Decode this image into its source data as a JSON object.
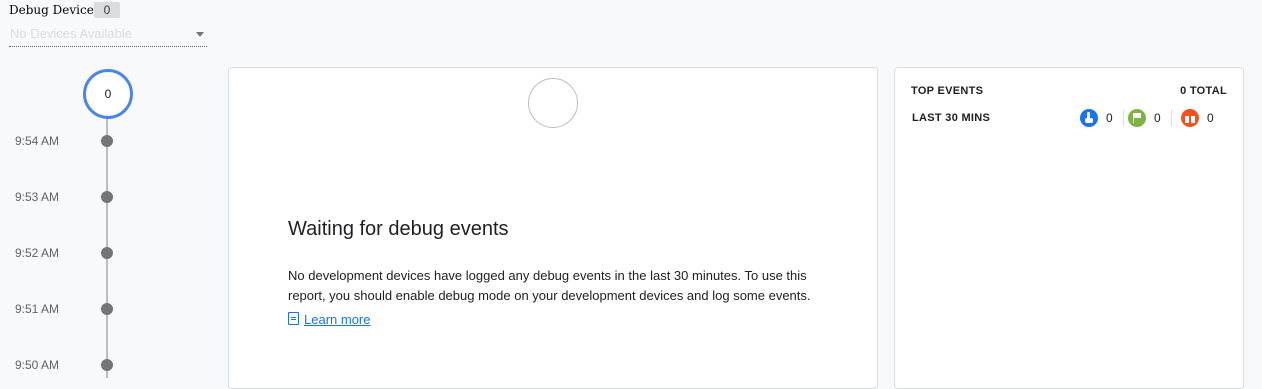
{
  "debug_device": {
    "label": "Debug Device",
    "count": "0",
    "selected": "No Devices Available"
  },
  "timeline": {
    "top_count": "0",
    "times": [
      "9:54 AM",
      "9:53 AM",
      "9:52 AM",
      "9:51 AM",
      "9:50 AM"
    ]
  },
  "main": {
    "title": "Waiting for debug events",
    "body": "No development devices have logged any debug events in the last 30 minutes. To use this report, you should enable debug mode on your development devices and log some events.",
    "link": "Learn more"
  },
  "top_events": {
    "title": "TOP EVENTS",
    "total": "0 TOTAL",
    "period": "LAST 30 MINS",
    "counts": [
      {
        "icon": "touch-icon",
        "value": "0",
        "color": "#1a73e8"
      },
      {
        "icon": "flag-icon",
        "value": "0",
        "color": "#7cb342"
      },
      {
        "icon": "gift-icon",
        "value": "0",
        "color": "#f4511e"
      }
    ]
  }
}
